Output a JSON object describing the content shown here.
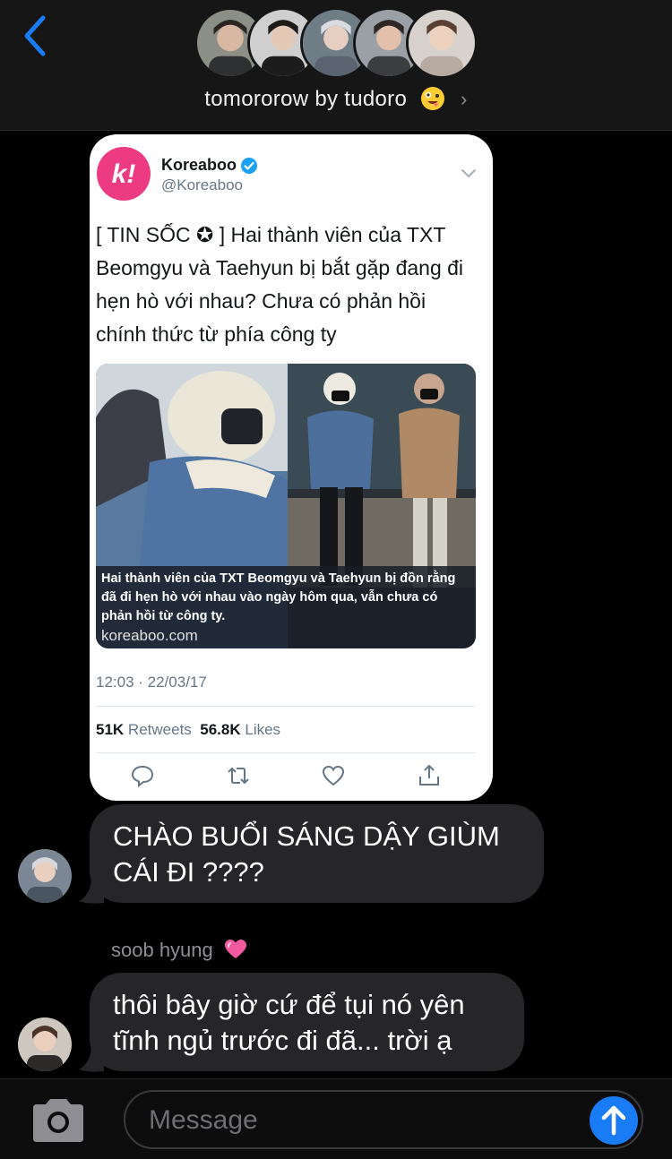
{
  "header": {
    "group_name": "tomororow by tudoro",
    "group_emoji": "zany-face-emoji",
    "member_avatars": [
      "member-1",
      "member-2",
      "member-3",
      "member-4",
      "member-5"
    ]
  },
  "tweet": {
    "account_name": "Koreaboo",
    "account_handle": "@Koreaboo",
    "logo_letter": "k!",
    "text": "[ TIN SỐC ✪ ] Hai thành viên của TXT Beomgyu và Taehyun bị bắt gặp đang đi hẹn hò với nhau? Chưa có phản hồi chính thức từ phía công ty",
    "media_caption": "Hai thành viên của TXT Beomgyu và Taehyun bị đồn rằng đã đi hẹn hò với nhau vào ngày hôm qua, vẫn chưa có phản hồi từ công ty.",
    "media_domain": "koreaboo.com",
    "timestamp": "12:03 · 22/03/17",
    "retweets_count": "51K",
    "retweets_label": "Retweets",
    "likes_count": "56.8K",
    "likes_label": "Likes"
  },
  "messages": [
    {
      "text": "CHÀO BUỔI SÁNG DẬY GIÙM CÁI ĐI ????"
    },
    {
      "sender": "soob hyung",
      "sender_emoji": "pink-heart-emoji",
      "text": "thôi bây giờ cứ để tụi nó yên tĩnh ngủ trước đi đã... trời ạ"
    }
  ],
  "composer": {
    "placeholder": "Message"
  },
  "colors": {
    "background": "#000000",
    "bubble": "#262628",
    "accent": "#1a7cf5",
    "koreaboo_pink": "#ec3b83"
  }
}
